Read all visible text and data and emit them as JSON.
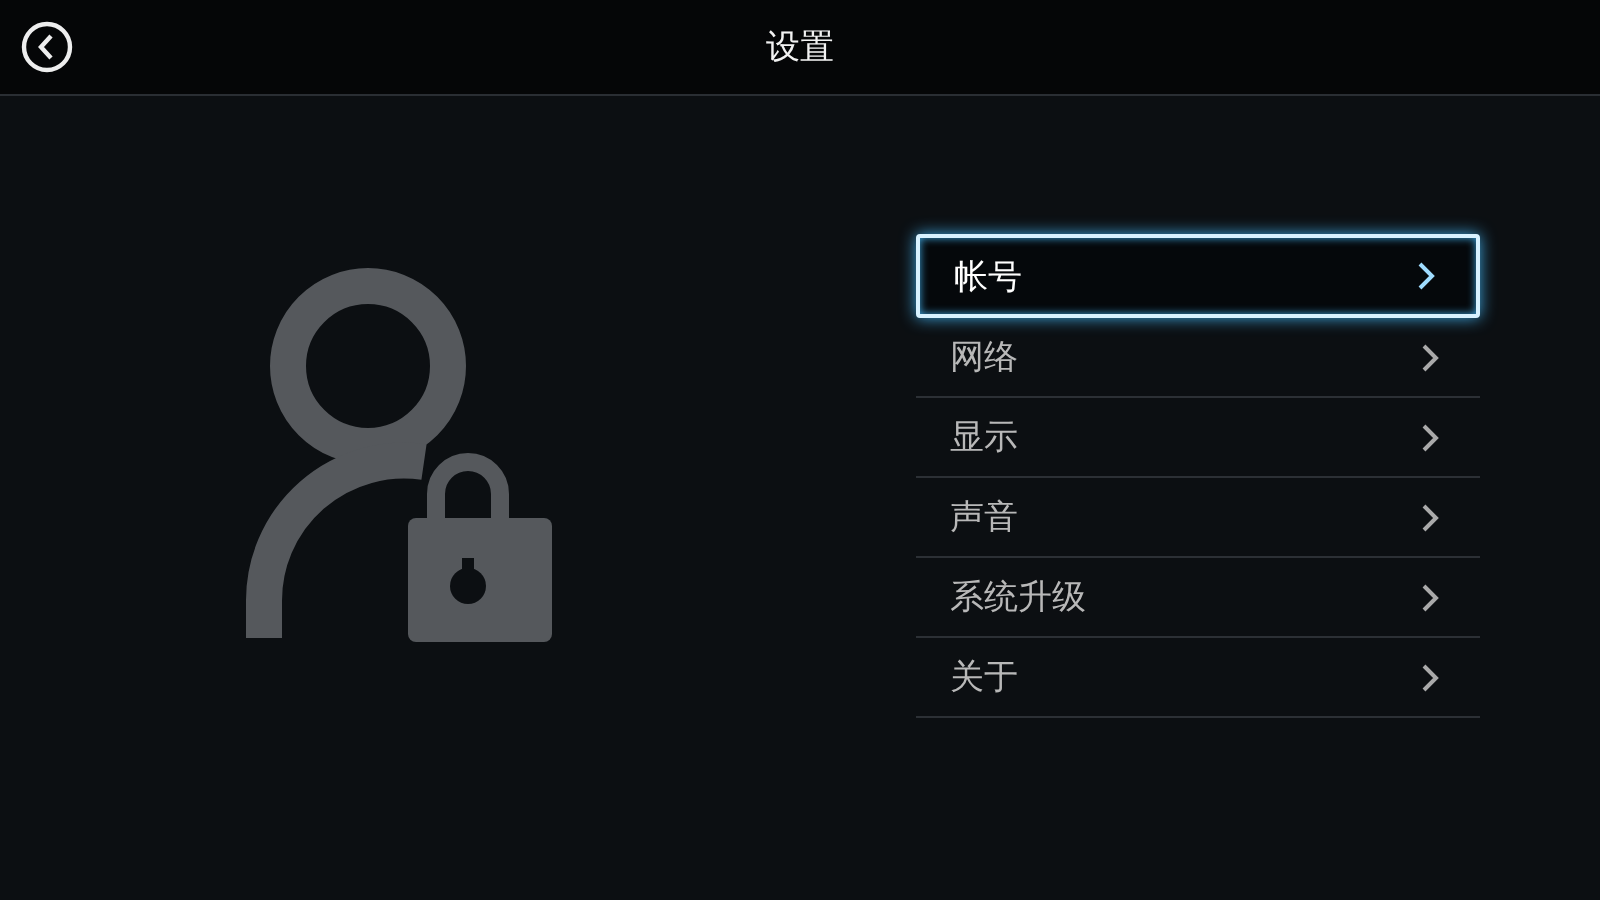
{
  "header": {
    "title": "设置"
  },
  "menu": [
    {
      "label": "帐号",
      "selected": true
    },
    {
      "label": "网络",
      "selected": false
    },
    {
      "label": "显示",
      "selected": false
    },
    {
      "label": "声音",
      "selected": false
    },
    {
      "label": "系统升级",
      "selected": false
    },
    {
      "label": "关于",
      "selected": false
    }
  ]
}
